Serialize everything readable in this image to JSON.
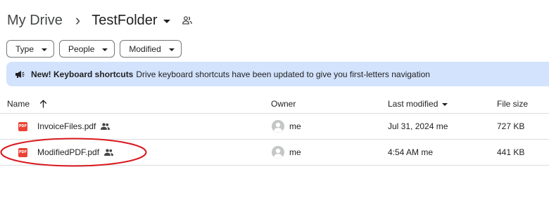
{
  "breadcrumb": {
    "root": "My Drive",
    "separator": "›",
    "current": "TestFolder"
  },
  "filters": [
    {
      "label": "Type"
    },
    {
      "label": "People"
    },
    {
      "label": "Modified"
    }
  ],
  "banner": {
    "title": "New! Keyboard shortcuts",
    "message": "Drive keyboard shortcuts have been updated to give you first-letters navigation"
  },
  "table": {
    "columns": {
      "name": "Name",
      "owner": "Owner",
      "last_modified": "Last modified",
      "file_size": "File size"
    },
    "rows": [
      {
        "name": "InvoiceFiles.pdf",
        "owner": "me",
        "last_modified": "Jul 31, 2024 me",
        "file_size": "727 KB",
        "type_badge": "PDF"
      },
      {
        "name": "ModifiedPDF.pdf",
        "owner": "me",
        "last_modified": "4:54 AM me",
        "file_size": "441 KB",
        "type_badge": "PDF"
      }
    ]
  },
  "colors": {
    "banner_bg": "#d3e3fd",
    "pdf_red": "#ea4335",
    "highlight_oval": "#d9191f"
  },
  "icons": {
    "shared_folder": "people-icon",
    "banner": "megaphone-icon",
    "sort": "arrow-up-icon",
    "owner": "account-circle-icon",
    "file": "pdf-icon"
  }
}
